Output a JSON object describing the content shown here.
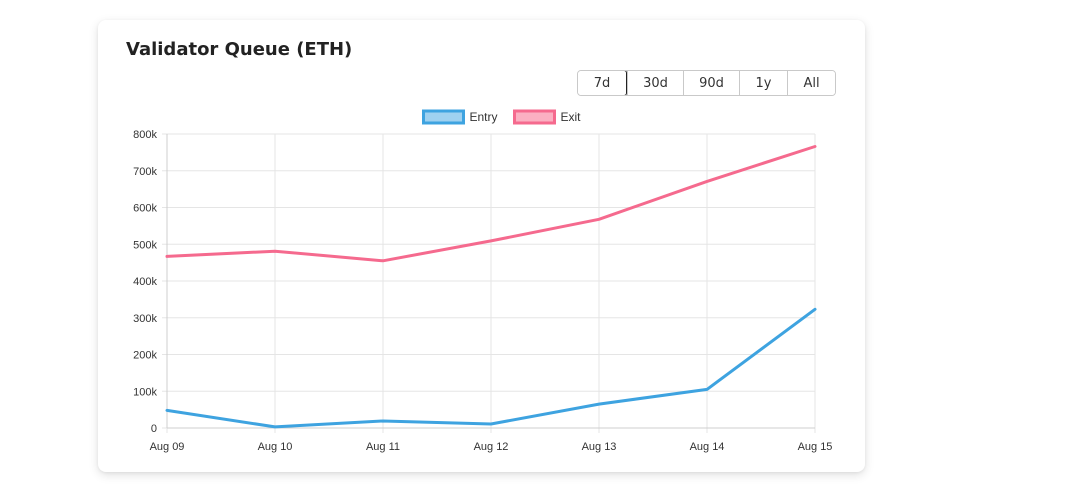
{
  "card": {
    "title": "Validator Queue (ETH)"
  },
  "range_selector": {
    "options": [
      "7d",
      "30d",
      "90d",
      "1y",
      "All"
    ],
    "selected": "7d"
  },
  "chart_data": {
    "type": "line",
    "title": "",
    "xlabel": "",
    "ylabel": "",
    "categories": [
      "Aug 09",
      "Aug 10",
      "Aug 11",
      "Aug 12",
      "Aug 13",
      "Aug 14",
      "Aug 15"
    ],
    "series": [
      {
        "name": "Entry",
        "values": [
          48000,
          3000,
          19000,
          11000,
          65000,
          105000,
          323000
        ],
        "color": "#3ea3e0",
        "fill": "#9fd1f0"
      },
      {
        "name": "Exit",
        "values": [
          467000,
          481000,
          455000,
          509000,
          568000,
          671000,
          766000
        ],
        "color": "#f56a8e",
        "fill": "#fbb0c2"
      }
    ],
    "ylim": [
      0,
      800000
    ],
    "yticks": [
      0,
      100000,
      200000,
      300000,
      400000,
      500000,
      600000,
      700000,
      800000
    ],
    "ytick_labels": [
      "0",
      "100k",
      "200k",
      "300k",
      "400k",
      "500k",
      "600k",
      "700k",
      "800k"
    ],
    "grid": true,
    "legend": "top-center"
  }
}
